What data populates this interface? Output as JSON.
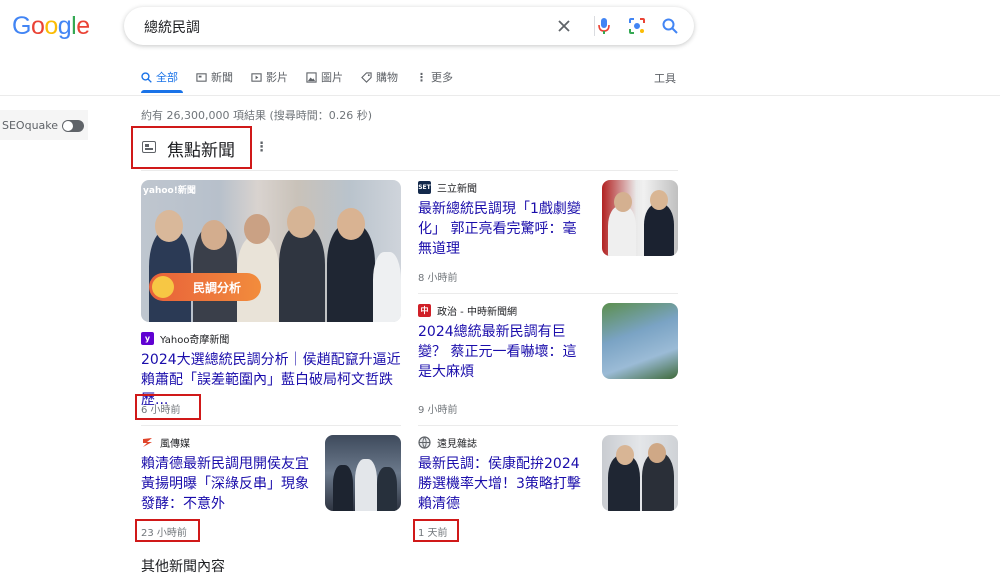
{
  "logo": {
    "letters": [
      "G",
      "o",
      "o",
      "g",
      "l",
      "e"
    ]
  },
  "search": {
    "query": "總統民調"
  },
  "tabs": [
    {
      "label": "全部",
      "icon": "search-icon",
      "active": true
    },
    {
      "label": "新聞",
      "icon": "newspaper-icon"
    },
    {
      "label": "影片",
      "icon": "video-icon"
    },
    {
      "label": "圖片",
      "icon": "image-icon"
    },
    {
      "label": "購物",
      "icon": "tag-icon"
    },
    {
      "label": "更多",
      "icon": "more-vertical-icon"
    }
  ],
  "tools_label": "工具",
  "result_stats": "約有 26,300,000 項結果 (搜尋時間：0.26 秒)",
  "seoquake": {
    "label": "SEOquake"
  },
  "top_stories": {
    "title": "焦點新聞",
    "featured": {
      "image_badge": "民調分析",
      "image_brand": "yahoo!新聞",
      "source": "Yahoo奇摩新聞",
      "headline": "2024大選總統民調分析｜侯趙配竄升逼近賴蕭配「誤差範圍內」藍白破局柯文哲跌歷...",
      "time": "6 小時前"
    },
    "second_left": {
      "source": "風傳媒",
      "headline": "賴清德最新民調甩開侯友宜 黃揚明曝「深綠反串」現象發酵：不意外",
      "time": "23 小時前"
    },
    "right": [
      {
        "source": "三立新聞",
        "favicon_text": "SET",
        "headline": "最新總統民調現「1戲劇變化」 郭正亮看完驚呼：毫無道理",
        "time": "8 小時前"
      },
      {
        "source": "政治 - 中時新聞網",
        "favicon_text": "中",
        "headline": "2024總統最新民調有巨變？ 蔡正元一看嚇壞：這是大麻煩",
        "time": "9 小時前"
      },
      {
        "source": "遠見雜誌",
        "favicon_text": "",
        "headline": "最新民調：侯康配拚2024勝選機率大增！3策略打擊賴清德",
        "time": "1 天前"
      }
    ]
  },
  "more_news": "其他新聞內容",
  "colors": {
    "accent": "#1a73e8",
    "link": "#1a0dab",
    "highlight": "#d01919"
  }
}
